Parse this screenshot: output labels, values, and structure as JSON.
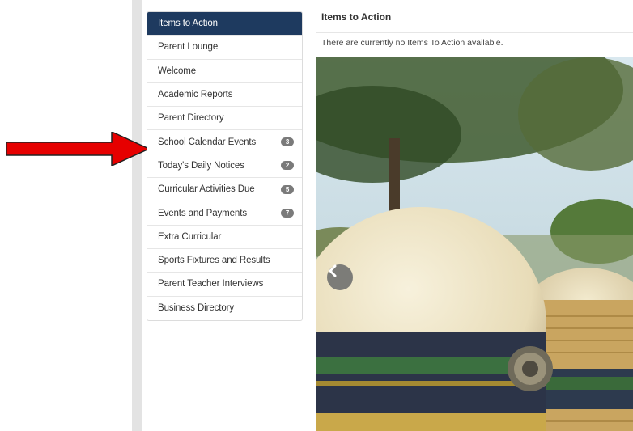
{
  "sidebar": {
    "items": [
      {
        "label": "Items to Action",
        "badge": ""
      },
      {
        "label": "Parent Lounge",
        "badge": ""
      },
      {
        "label": "Welcome",
        "badge": ""
      },
      {
        "label": "Academic Reports",
        "badge": ""
      },
      {
        "label": "Parent Directory",
        "badge": ""
      },
      {
        "label": "School Calendar Events",
        "badge": "3"
      },
      {
        "label": "Today's Daily Notices",
        "badge": "2"
      },
      {
        "label": "Curricular Activities Due",
        "badge": "5"
      },
      {
        "label": "Events and Payments",
        "badge": "7"
      },
      {
        "label": "Extra Curricular",
        "badge": ""
      },
      {
        "label": "Sports Fixtures and Results",
        "badge": ""
      },
      {
        "label": "Parent Teacher Interviews",
        "badge": ""
      },
      {
        "label": "Business Directory",
        "badge": ""
      }
    ]
  },
  "main": {
    "title": "Items to Action",
    "message": "There are currently no Items To Action available."
  },
  "carousel": {
    "prev_icon": "chevron-left-icon",
    "image": "school hats photo"
  },
  "annotation": {
    "arrow_color": "#e60000"
  },
  "colors": {
    "active_bg": "#1e3a5f",
    "badge_bg": "#7a7a7a"
  }
}
